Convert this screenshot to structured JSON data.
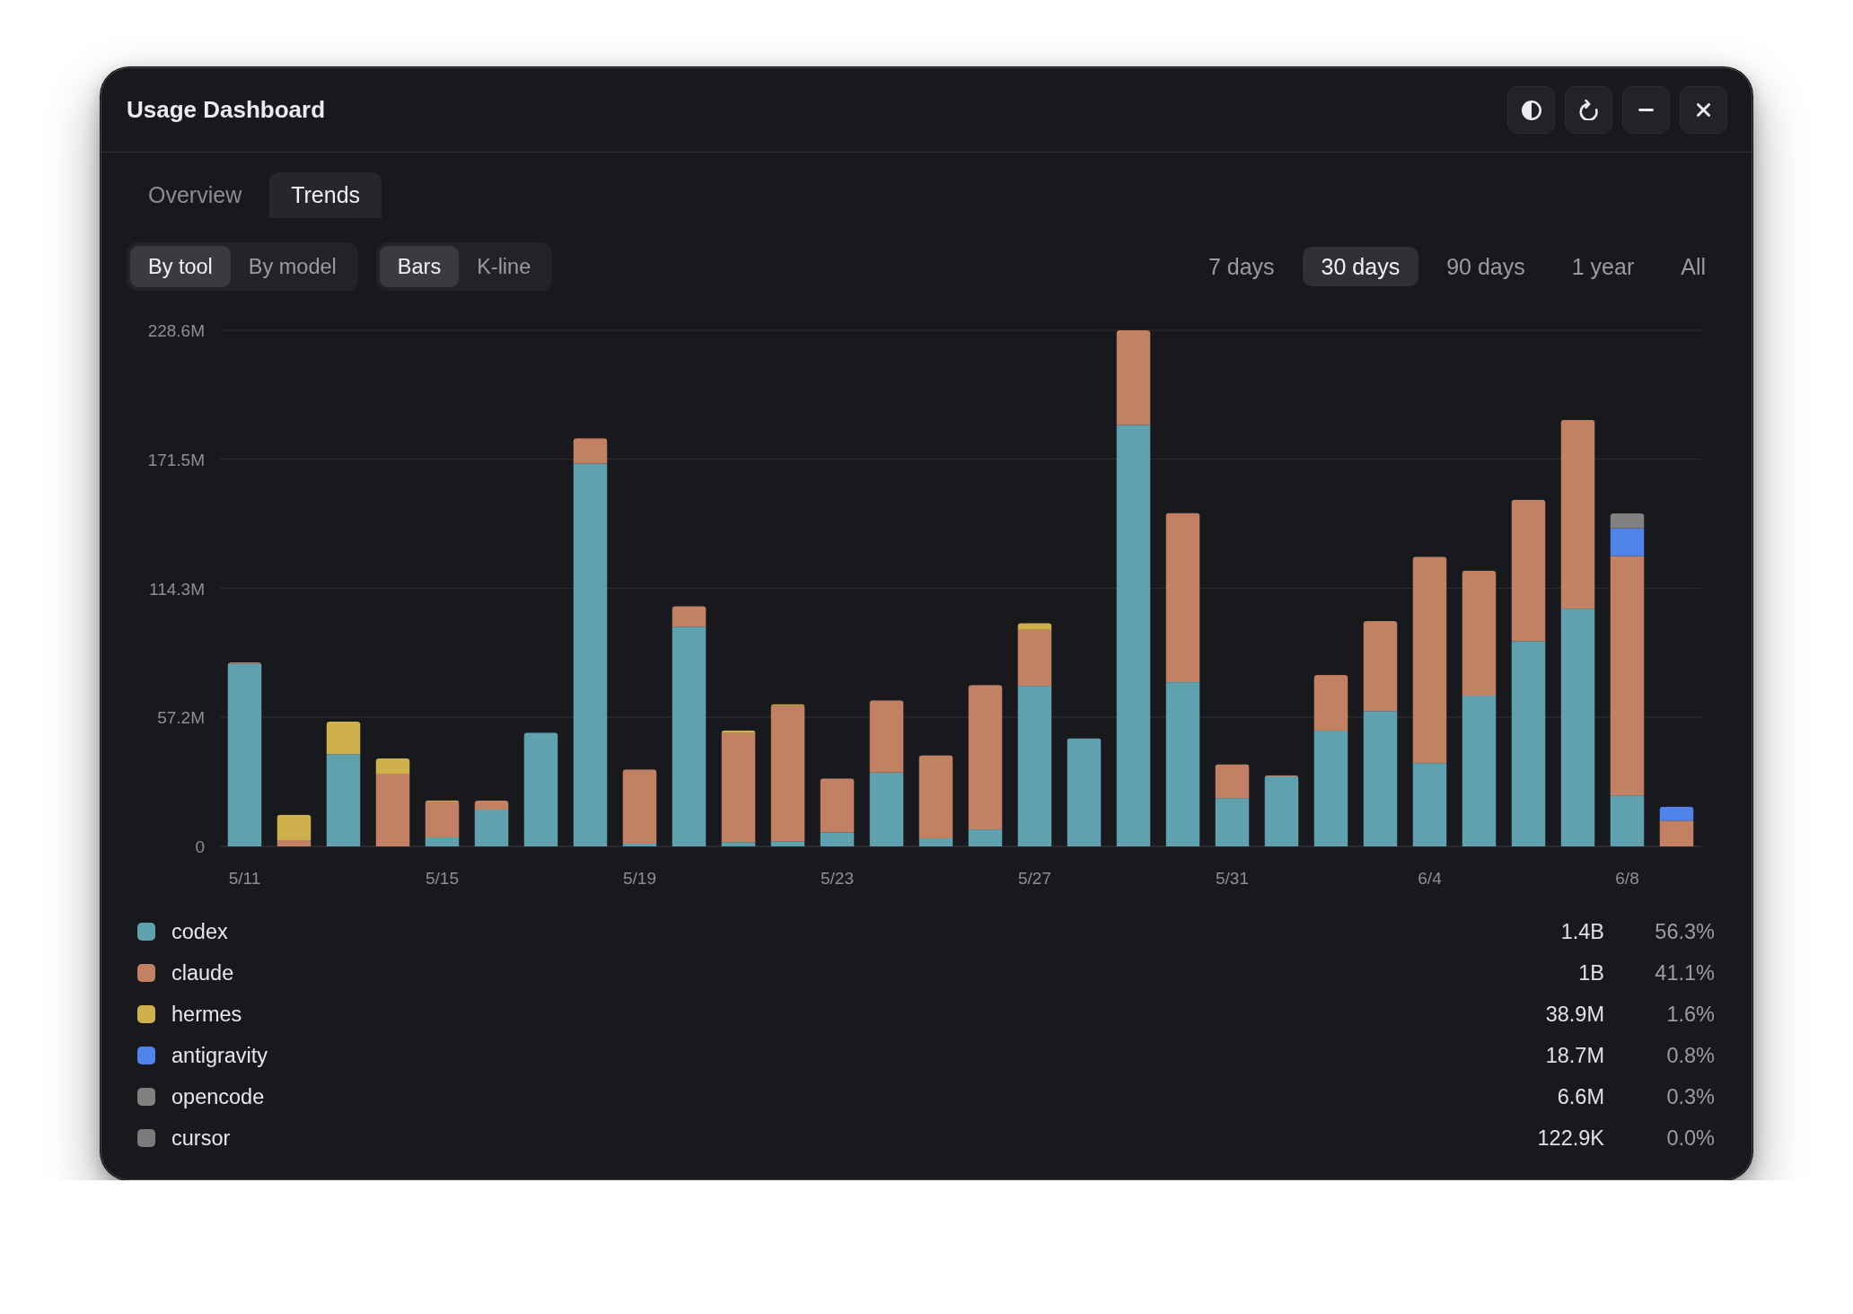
{
  "window": {
    "title": "Usage Dashboard"
  },
  "tabs": [
    {
      "label": "Overview",
      "selected": false
    },
    {
      "label": "Trends",
      "selected": true
    }
  ],
  "group_by": [
    {
      "label": "By tool",
      "selected": true
    },
    {
      "label": "By model",
      "selected": false
    }
  ],
  "view_mode": [
    {
      "label": "Bars",
      "selected": true
    },
    {
      "label": "K-line",
      "selected": false
    }
  ],
  "ranges": [
    {
      "label": "7 days",
      "selected": false
    },
    {
      "label": "30 days",
      "selected": true
    },
    {
      "label": "90 days",
      "selected": false
    },
    {
      "label": "1 year",
      "selected": false
    },
    {
      "label": "All",
      "selected": false
    }
  ],
  "usage_chart": {
    "chart_data": [
      {
        "type": "bar",
        "stacked": true,
        "grid": true,
        "categories": [
          "5/11",
          null,
          null,
          null,
          "5/15",
          null,
          null,
          null,
          "5/19",
          null,
          null,
          null,
          "5/23",
          null,
          null,
          null,
          "5/27",
          null,
          null,
          null,
          "5/31",
          null,
          null,
          null,
          "6/4",
          null,
          null,
          null,
          "6/8",
          null
        ],
        "ylim": [
          0,
          228.6
        ],
        "yticks": [
          {
            "value": 0,
            "label": "0"
          },
          {
            "value": 57.2,
            "label": "57.2M"
          },
          {
            "value": 114.3,
            "label": "114.3M"
          },
          {
            "value": 171.5,
            "label": "171.5M"
          },
          {
            "value": 228.6,
            "label": "228.6M"
          }
        ],
        "series": [
          {
            "name": "codex",
            "color": "#5fa1ae",
            "values": [
              81.0,
              0,
              40.8,
              0,
              4.0,
              16.3,
              50.4,
              169.6,
              1.2,
              97.3,
              1.9,
              2.3,
              6.1,
              32.7,
              3.6,
              7.5,
              71.1,
              47.9,
              186.7,
              72.7,
              21.4,
              31.0,
              51.3,
              59.9,
              36.9,
              66.8,
              90.9,
              105.3,
              22.6,
              0
            ]
          },
          {
            "name": "claude",
            "color": "#c38163",
            "values": [
              0.5,
              2.8,
              0,
              32.2,
              15.9,
              4.0,
              0,
              11.2,
              32.9,
              9.1,
              48.3,
              60.0,
              24.0,
              32.0,
              36.8,
              64.0,
              24.8,
              0,
              41.9,
              75.0,
              15.0,
              0.5,
              24.6,
              39.9,
              91.4,
              55.4,
              62.7,
              83.6,
              106.0,
              11.4
            ]
          },
          {
            "name": "hermes",
            "color": "#cfb14c",
            "values": [
              0,
              11.2,
              14.5,
              6.8,
              0.5,
              0,
              0,
              0,
              0,
              0,
              1.2,
              0.7,
              0,
              0,
              0,
              0,
              3.0,
              0,
              0,
              0,
              0,
              0,
              0,
              0,
              0,
              0,
              0,
              0,
              0,
              0
            ]
          },
          {
            "name": "antigravity",
            "color": "#4f83ea",
            "values": [
              0,
              0,
              0,
              0,
              0,
              0,
              0,
              0,
              0,
              0,
              0,
              0,
              0,
              0,
              0,
              0,
              0,
              0,
              0,
              0,
              0,
              0,
              0,
              0,
              0,
              0,
              0,
              0,
              12.3,
              6.2
            ]
          },
          {
            "name": "opencode",
            "color": "#808080",
            "values": [
              0,
              0,
              0,
              0,
              0,
              0,
              0,
              0,
              0,
              0,
              0,
              0,
              0,
              0,
              0,
              0,
              0,
              0,
              0,
              0,
              0,
              0,
              0,
              0,
              0,
              0,
              0,
              0,
              6.6,
              0
            ]
          },
          {
            "name": "cursor",
            "color": "#7a7a7a",
            "values": [
              0,
              0,
              0,
              0,
              0,
              0,
              0,
              0,
              0,
              0,
              0,
              0,
              0,
              0,
              0,
              0,
              0,
              0,
              0,
              0,
              0,
              0,
              0,
              0,
              0,
              0,
              0,
              0,
              0,
              0
            ]
          }
        ]
      }
    ],
    "legend_rows": [
      {
        "total": "1.4B",
        "share": "56.3%"
      },
      {
        "total": "1B",
        "share": "41.1%"
      },
      {
        "total": "38.9M",
        "share": "1.6%"
      },
      {
        "total": "18.7M",
        "share": "0.8%"
      },
      {
        "total": "6.6M",
        "share": "0.3%"
      },
      {
        "total": "122.9K",
        "share": "0.0%"
      }
    ]
  }
}
